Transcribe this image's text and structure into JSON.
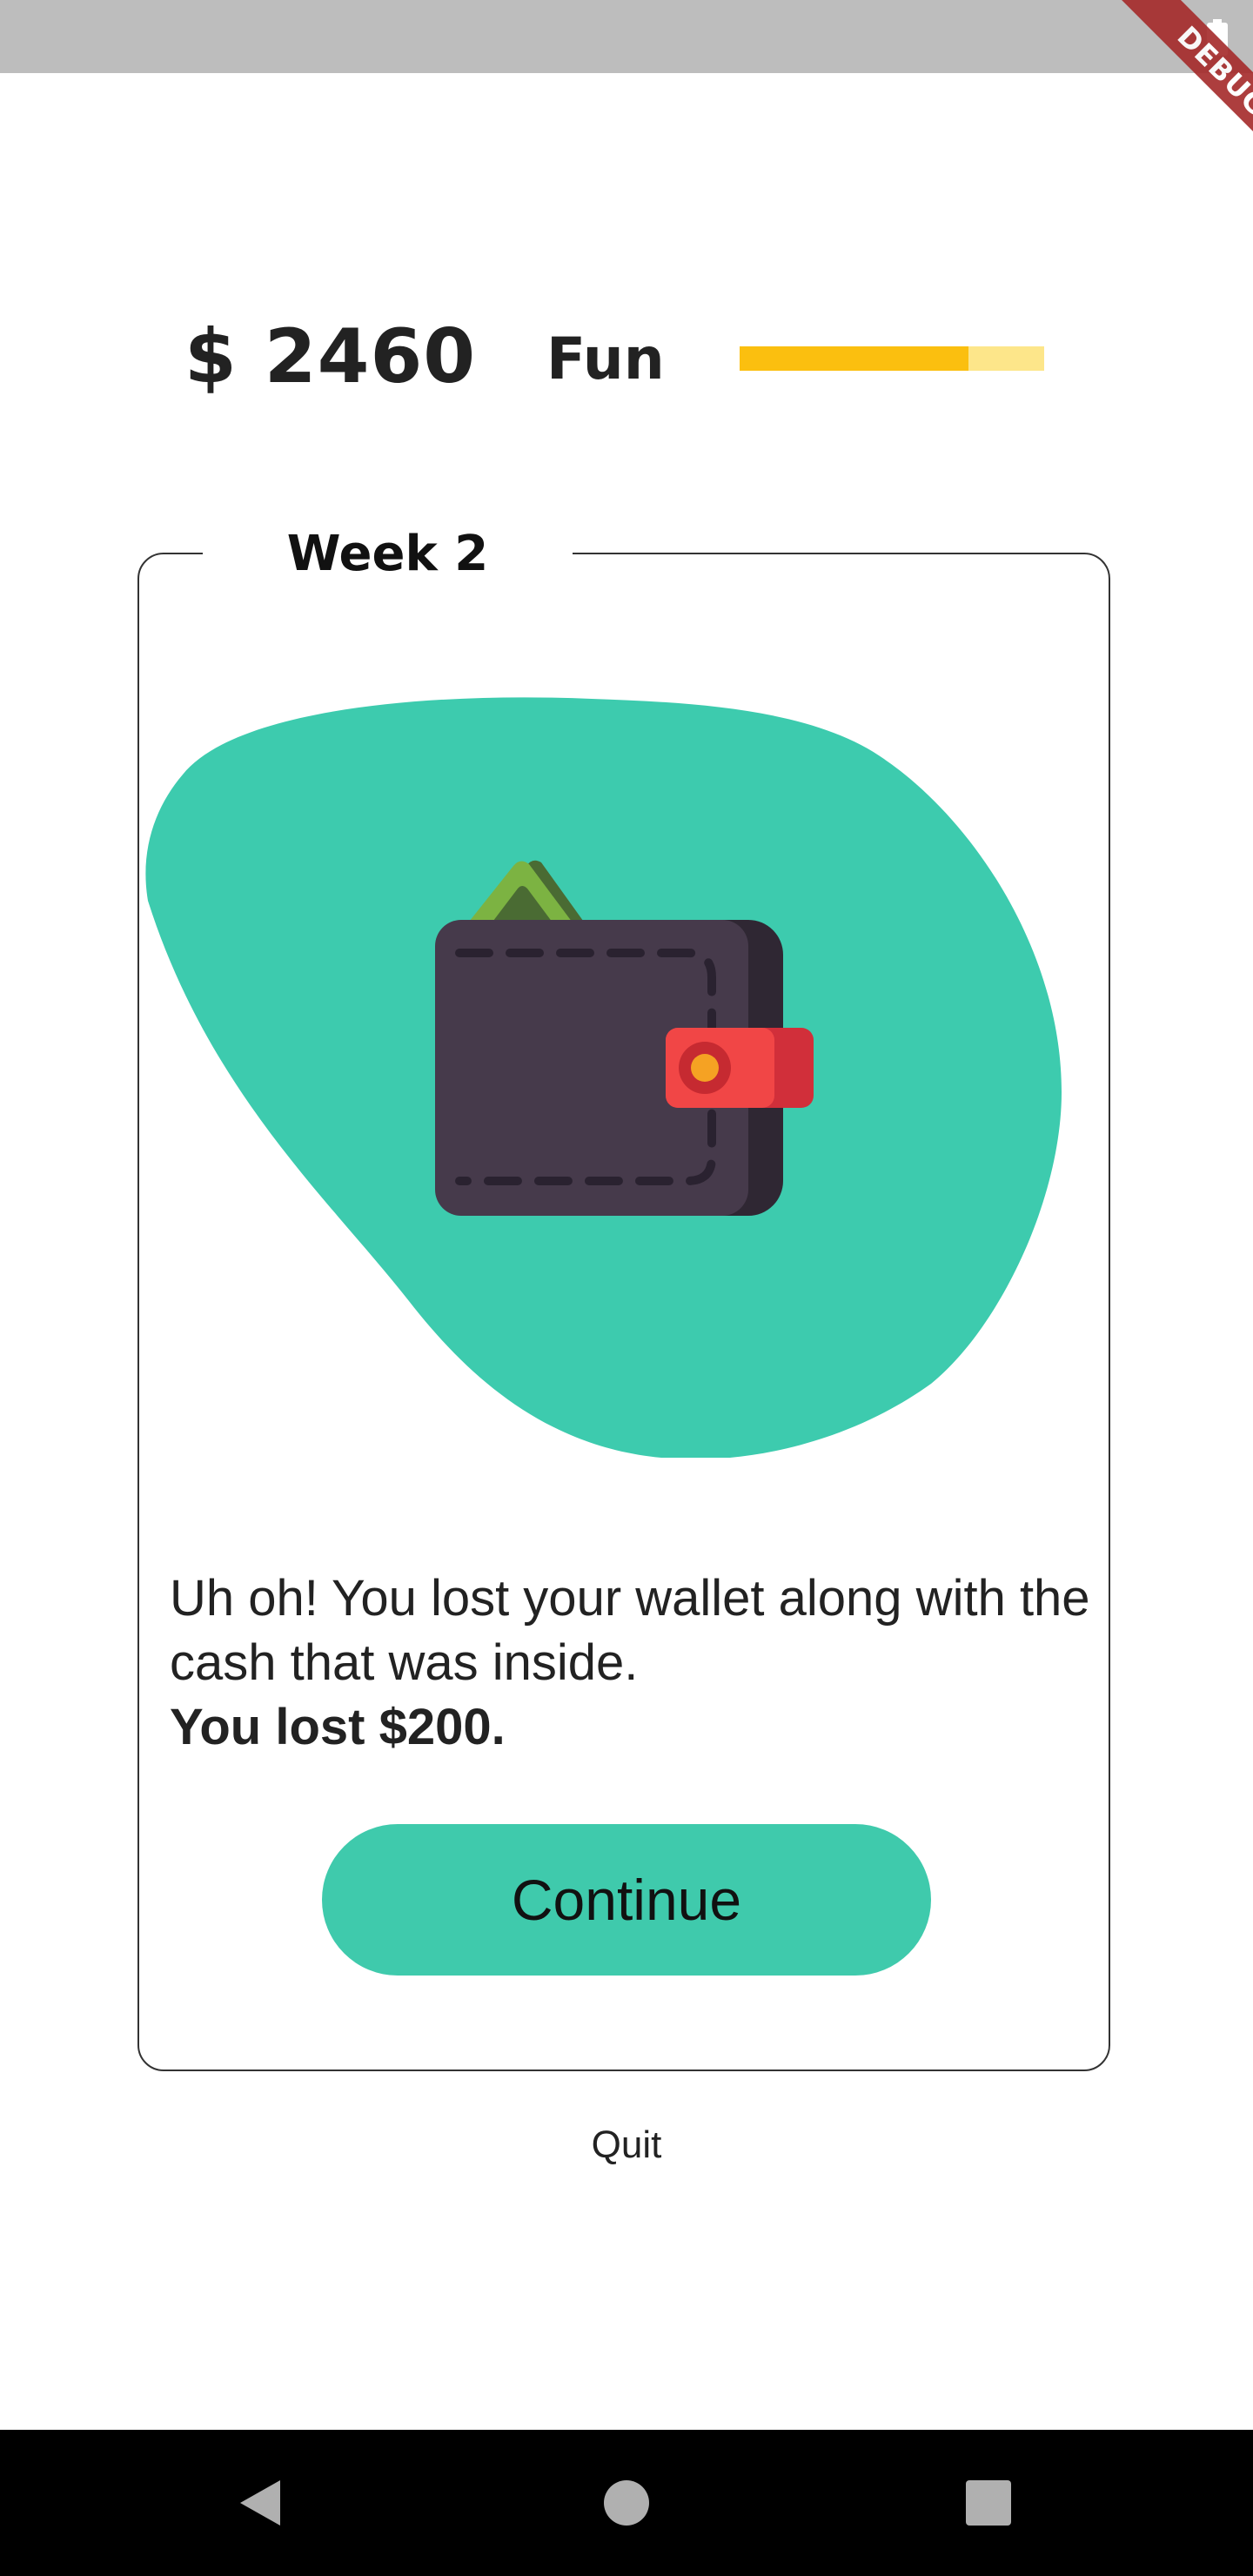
{
  "status_bar": {
    "battery_icon": "battery-full-icon"
  },
  "debug_banner": {
    "label": "DEBUG",
    "color": "#a52a2a"
  },
  "header": {
    "money": "$ 2460",
    "fun_label": "Fun",
    "fun_level": 0.75,
    "fun_bar_colors": {
      "fill": "#fbbf0f",
      "track": "#fde68a"
    }
  },
  "card": {
    "title": "Week 2",
    "illustration": "wallet-with-cash-icon",
    "blob_color": "#3dcbae",
    "message": "Uh oh! You lost your wallet along with the cash that was inside.",
    "message_strong": "You lost $200.",
    "continue_label": "Continue",
    "button_color": "#3fcaac"
  },
  "quit_label": "Quit",
  "nav": {
    "back_icon": "back-triangle-icon",
    "home_icon": "home-circle-icon",
    "recents_icon": "recents-square-icon"
  }
}
